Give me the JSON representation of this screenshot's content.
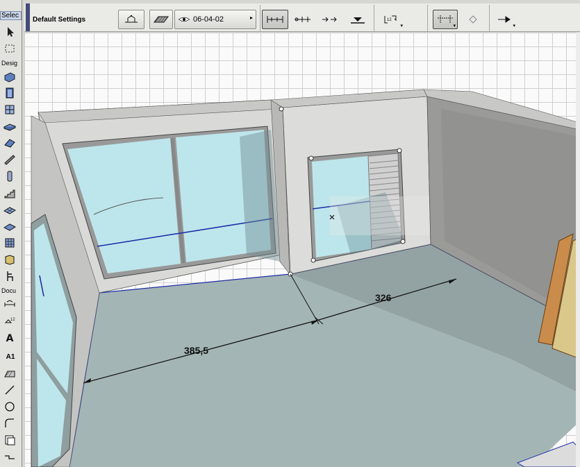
{
  "toolbox": {
    "select_header": "Selec",
    "design_header": "Desig",
    "document_header": "Docu",
    "text_tool_label": "A",
    "label_tool_label": "A1"
  },
  "infobox": {
    "title": "Default Settings",
    "layer_value": "06-04-02"
  },
  "canvas": {
    "dimension_1": "385,5",
    "dimension_2": "326"
  },
  "colors": {
    "glass": "#bde6ec",
    "floor": "#9fb1b1",
    "wall": "#d9d9d7",
    "selection_blue": "#1f2fa8"
  }
}
